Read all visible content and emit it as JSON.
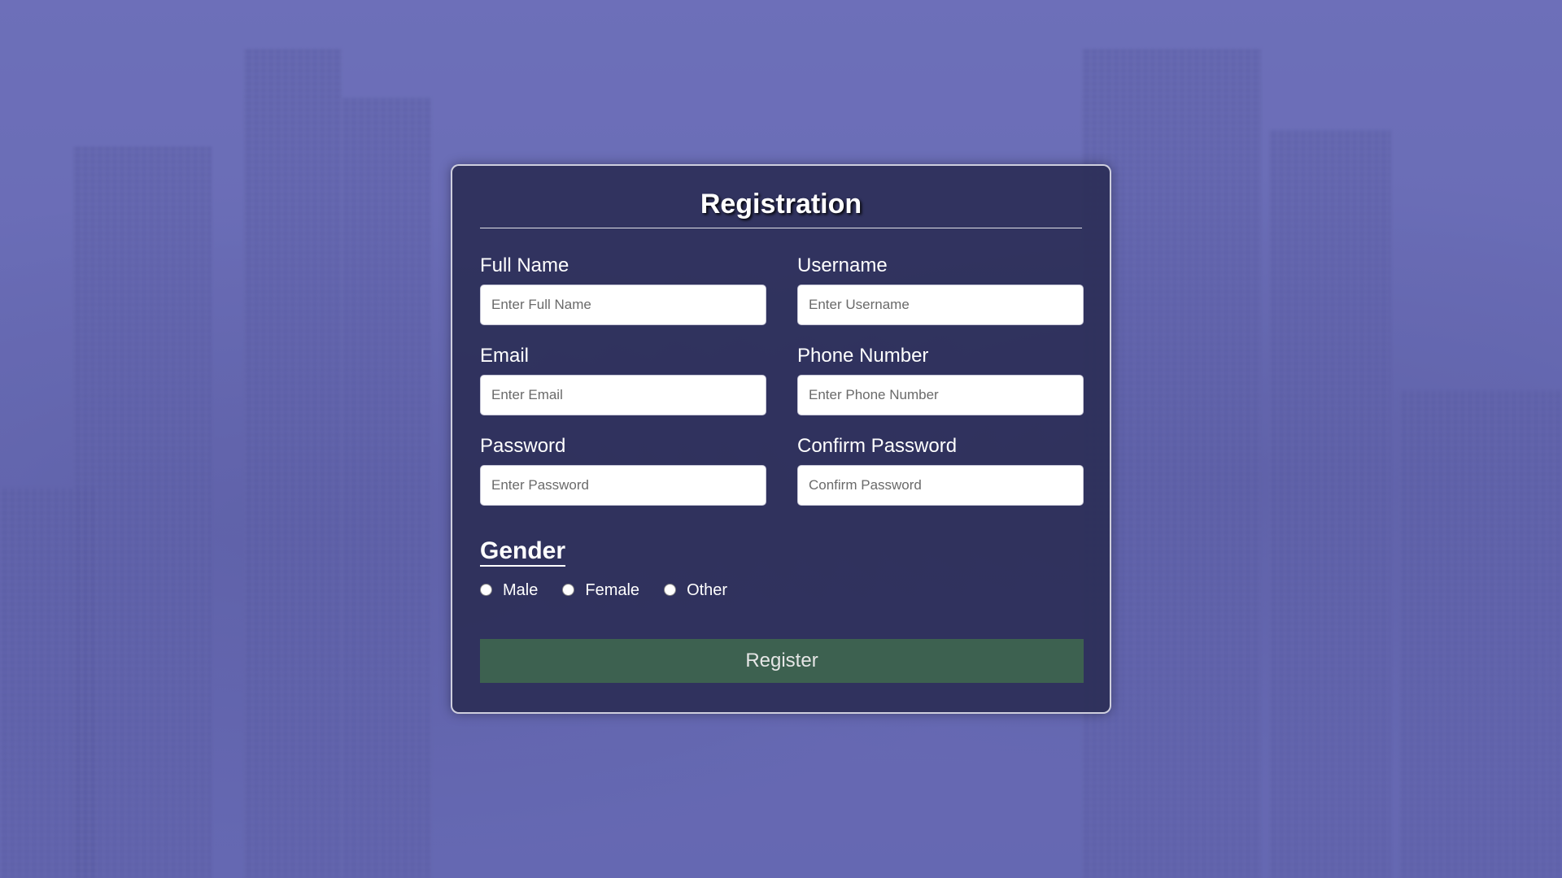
{
  "form": {
    "title": "Registration",
    "fields": [
      {
        "label": "Full Name",
        "placeholder": "Enter Full Name",
        "value": ""
      },
      {
        "label": "Username",
        "placeholder": "Enter Username",
        "value": ""
      },
      {
        "label": "Email",
        "placeholder": "Enter Email",
        "value": ""
      },
      {
        "label": "Phone Number",
        "placeholder": "Enter Phone Number",
        "value": ""
      },
      {
        "label": "Password",
        "placeholder": "Enter Password",
        "value": ""
      },
      {
        "label": "Confirm Password",
        "placeholder": "Confirm Password",
        "value": ""
      }
    ],
    "gender": {
      "title": "Gender",
      "options": [
        "Male",
        "Female",
        "Other"
      ],
      "selected": null
    },
    "submit_label": "Register"
  },
  "colors": {
    "background": "#6d70b6",
    "card": "#282a50",
    "button": "#3d6150",
    "button_text": "#e6e6e6"
  }
}
